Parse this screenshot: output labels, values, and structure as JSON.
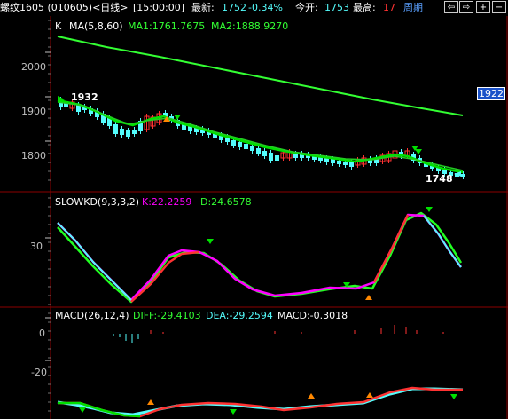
{
  "toolbar": {
    "instrument": "螺纹1605 (010605)<日线>",
    "time": "[15:00:00]",
    "latest_label": "最新:",
    "latest_value": "1752",
    "change": "-0.34%",
    "open_label": "今开:",
    "open_value": "1753",
    "high_label": "最高:",
    "high_value": "17",
    "period_label": "周期",
    "buttons": {
      "prev": "⇦",
      "next": "⇨",
      "plus": "+",
      "minus": "−"
    }
  },
  "kline": {
    "name": "K",
    "indicator": "MA(5,8,60)",
    "ma1": "MA1:1761.7675",
    "ma2": "MA2:1888.9270",
    "y_ticks": [
      "2000",
      "1900",
      "1800"
    ],
    "high_label": "1932",
    "low_label": "1748",
    "price_tag": "1922"
  },
  "slowkd": {
    "indicator": "SLOWKD(9,3,3,2)",
    "k": "K:22.2259",
    "d": "D:24.6578",
    "y_ticks": [
      "30"
    ]
  },
  "macd": {
    "indicator": "MACD(26,12,4)",
    "diff": "DIFF:-29.4103",
    "dea": "DEA:-29.2594",
    "macd": "MACD:-0.3018",
    "y_ticks": [
      "0",
      "-20"
    ]
  },
  "colors": {
    "bg": "#000000",
    "up": "#ff3232",
    "down": "#54fcfc",
    "ma_short": "#00e000",
    "ma_long": "#33ff33",
    "k_line": "#ff00ff",
    "d_line": "#22ff22",
    "accent": "#ffff00",
    "panel_border": "#8b0000",
    "tick": "#c0c0c0"
  }
}
